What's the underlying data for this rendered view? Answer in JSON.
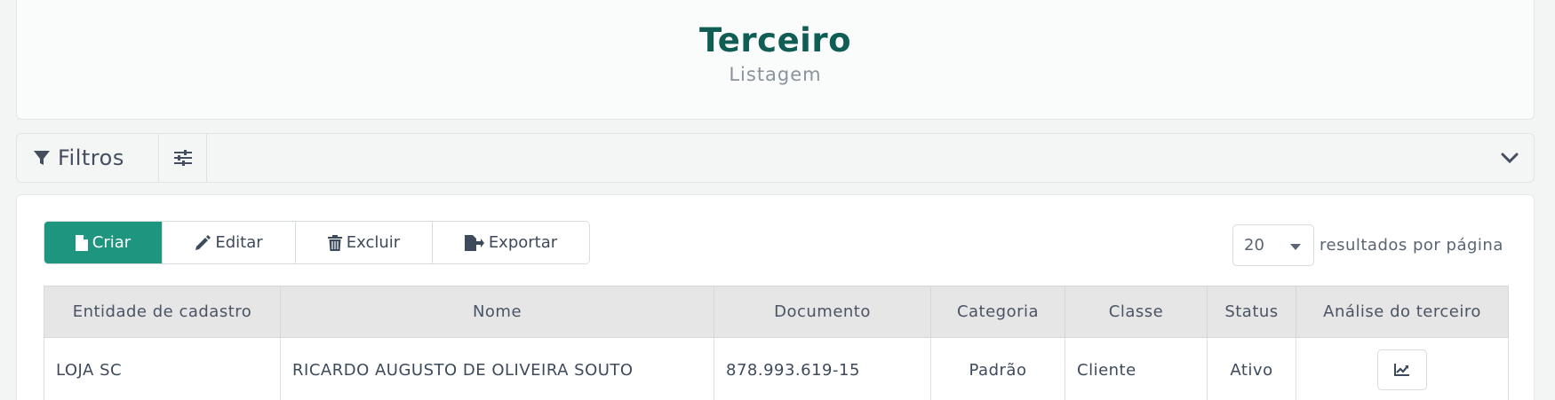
{
  "header": {
    "title": "Terceiro",
    "subtitle": "Listagem"
  },
  "filters": {
    "label": "Filtros"
  },
  "toolbar": {
    "create_label": "Criar",
    "edit_label": "Editar",
    "delete_label": "Excluir",
    "export_label": "Exportar"
  },
  "pagination": {
    "page_size": "20",
    "page_size_label": "resultados por página"
  },
  "table": {
    "columns": [
      "Entidade de cadastro",
      "Nome",
      "Documento",
      "Categoria",
      "Classe",
      "Status",
      "Análise do terceiro"
    ],
    "rows": [
      {
        "entity": "LOJA SC",
        "name": "RICARDO AUGUSTO DE OLIVEIRA SOUTO",
        "document": "878.993.619-15",
        "category": "Padrão",
        "class": "Cliente",
        "status": "Ativo"
      }
    ]
  },
  "colors": {
    "primary": "#1e957f",
    "title": "#0f5d54"
  }
}
